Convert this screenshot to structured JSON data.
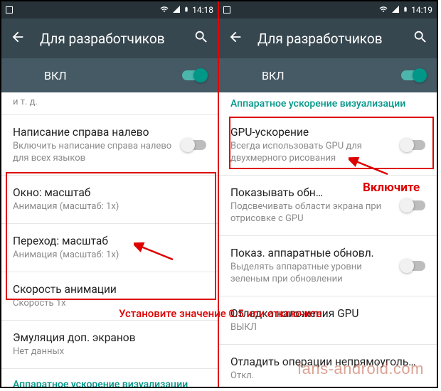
{
  "status": {
    "time_left": "14:18",
    "time_right": "14:19"
  },
  "header": {
    "title": "Для разработчиков"
  },
  "master": {
    "label": "ВКЛ"
  },
  "left": {
    "frag": "и т. д.",
    "items": [
      {
        "title": "Написание справа налево",
        "sub": "Включить написание справа налево для всех языков",
        "toggle": "off"
      },
      {
        "title": "Окно: масштаб",
        "sub": "Анимация (масштаб: 1x)"
      },
      {
        "title": "Переход: масштаб",
        "sub": "Анимация (масштаб: 1x)"
      },
      {
        "title": "Скорость анимации",
        "sub": "Скорость 1x"
      },
      {
        "title": "Эмуляция доп. экранов",
        "sub": "Нет данных"
      }
    ],
    "section": "Аппаратное ускорение визуализации"
  },
  "right": {
    "section": "Аппаратное ускорение визуализации",
    "items": [
      {
        "title": "GPU-ускорение",
        "sub": "Всегда использовать GPU для двухмерного рисования",
        "toggle": "off"
      },
      {
        "title": "Показывать обн…",
        "sub": "Подсвечивать области экрана при отрисовке с GPU",
        "toggle": "off"
      },
      {
        "title": "Показ. аппаратные обновл.",
        "sub": "Выделять аппаратные уровни зеленым при обновлении",
        "toggle": "off"
      },
      {
        "title": "Отладка наложения GPU",
        "sub": "ВЫКЛ"
      },
      {
        "title": "Отладить операции непрямоуголь…",
        "sub": "Откл."
      }
    ]
  },
  "annotations": {
    "enable": "Включите",
    "set_value": "Установите значение 0.5 или отключите"
  },
  "watermark": "fans-android.com"
}
